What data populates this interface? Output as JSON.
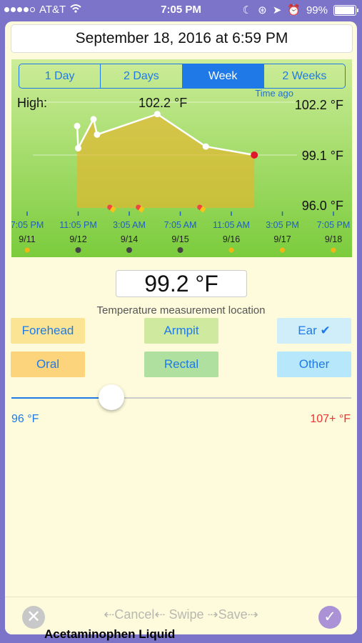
{
  "status": {
    "carrier": "AT&T",
    "time": "7:05 PM",
    "battery": "99%"
  },
  "date_title": "September 18, 2016 at 6:59 PM",
  "range_tabs": [
    {
      "label": "1 Day"
    },
    {
      "label": "2 Days"
    },
    {
      "label": "Week",
      "active": true
    },
    {
      "label": "2 Weeks"
    }
  ],
  "time_ago": "Time ago",
  "chart_data": {
    "type": "area",
    "high_label": "High:",
    "high_value": "102.2 °F",
    "y_tick_labels": [
      "102.2 °F",
      "99.1 °F",
      "96.0 °F"
    ],
    "ylim": [
      96.0,
      102.2
    ],
    "x_tick_times": [
      "7:05 PM",
      "11:05 PM",
      "3:05 AM",
      "7:05 AM",
      "11:05 AM",
      "3:05 PM",
      "7:05 PM"
    ],
    "x_tick_dates": [
      "9/11",
      "9/12",
      "9/14",
      "9/15",
      "9/16",
      "9/17",
      "9/18"
    ],
    "series": [
      {
        "x": [
          0.98,
          1.0,
          1.3,
          1.37,
          2.55,
          3.5,
          4.45
        ],
        "y": [
          100.8,
          99.5,
          101.2,
          100.3,
          101.5,
          99.6,
          99.1
        ]
      }
    ],
    "current_point": 99.1,
    "colors": {
      "area": "#e7b62d",
      "line": "#ffffff",
      "current": "#e0172a"
    }
  },
  "temperature": "99.2 °F",
  "location_heading": "Temperature measurement location",
  "locations": [
    {
      "label": "Forehead",
      "color": "#fbe594",
      "text": "#1f7ae8"
    },
    {
      "label": "Armpit",
      "color": "#cfe99e",
      "text": "#1f7ae8"
    },
    {
      "label": "Ear ✔",
      "color": "#cfeef9",
      "text": "#1f7ae8"
    },
    {
      "label": "Oral",
      "color": "#fbd47c",
      "text": "#1f7ae8"
    },
    {
      "label": "Rectal",
      "color": "#b0e0a0",
      "text": "#1f7ae8"
    },
    {
      "label": "Other",
      "color": "#b6e7fb",
      "text": "#1f7ae8"
    }
  ],
  "slider": {
    "min_label": "96 °F",
    "max_label": "107+ °F",
    "fraction": 0.28
  },
  "bottom": {
    "hint": "⇠Cancel⇠ Swipe ⇢Save⇢"
  },
  "behind_text": "Acetaminophen Liquid"
}
